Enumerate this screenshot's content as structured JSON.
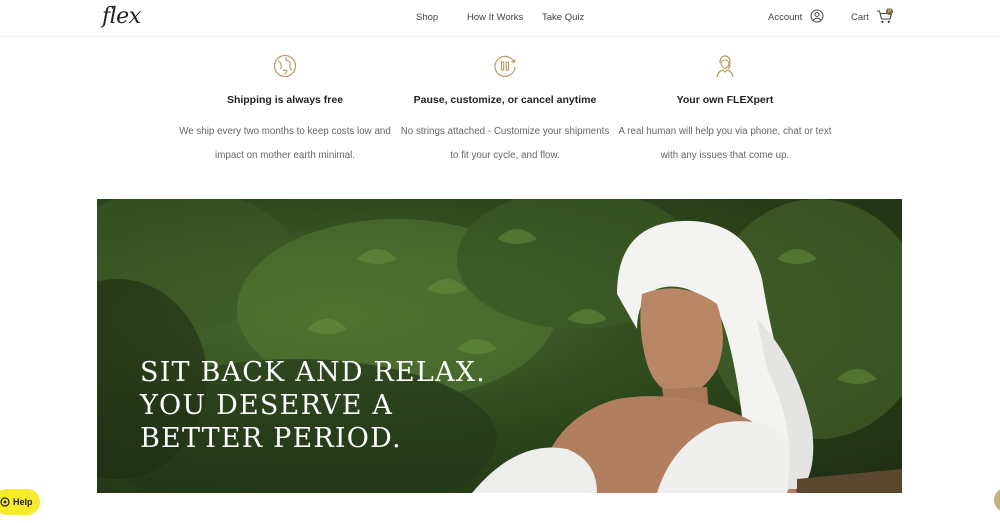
{
  "header": {
    "logo": "flex",
    "nav": [
      "Shop",
      "How It Works",
      "Take Quiz"
    ],
    "account_label": "Account",
    "cart_label": "Cart",
    "cart_count": "0"
  },
  "features": [
    {
      "icon": "globe-icon",
      "title": "Shipping is always free",
      "lines": [
        "We ship every two months to keep costs low and",
        "impact on mother earth minimal."
      ]
    },
    {
      "icon": "pause-cycle-icon",
      "title": "Pause, customize, or cancel anytime",
      "lines": [
        "No strings attached - Customize your shipments",
        "to fit your cycle, and flow."
      ]
    },
    {
      "icon": "flexpert-person-icon",
      "title": "Your own FLEXpert",
      "lines": [
        "A real human will help you via phone, chat or text",
        "with any issues that come up."
      ]
    }
  ],
  "hero": {
    "lines": [
      "SIT BACK AND RELAX.",
      "YOU DESERVE A",
      "BETTER PERIOD."
    ]
  },
  "help": {
    "label": "Help"
  },
  "colors": {
    "accent_gold": "#b89a5e",
    "help_yellow": "#f6ea2b"
  }
}
